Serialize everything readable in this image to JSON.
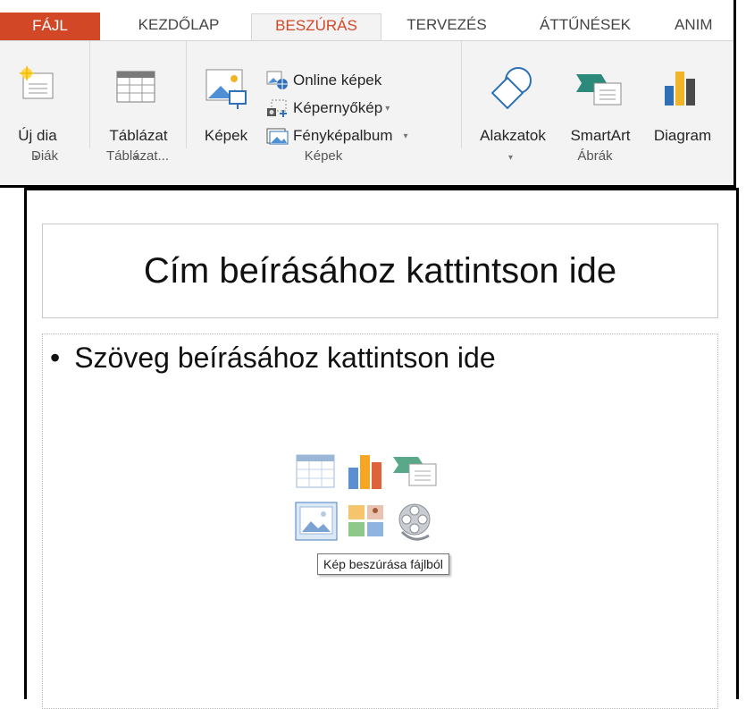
{
  "tabs": [
    {
      "label": "FÁJL"
    },
    {
      "label": "KEZDŐLAP"
    },
    {
      "label": "BESZÚRÁS"
    },
    {
      "label": "TERVEZÉS"
    },
    {
      "label": "ÁTTŰNÉSEK"
    },
    {
      "label": "ANIM"
    }
  ],
  "ribbon": {
    "new_slide": "Új dia",
    "table": "Táblázat",
    "pictures": "Képek",
    "online_pictures": "Online képek",
    "screenshot": "Képernyőkép",
    "photo_album": "Fényképalbum",
    "shapes": "Alakzatok",
    "smartart": "SmartArt",
    "chart": "Diagram",
    "groups": {
      "slides": "Diák",
      "tables": "Táblázat...",
      "images": "Képek",
      "illustrations": "Ábrák"
    }
  },
  "slide": {
    "title_placeholder": "Cím beírásához kattintson ide",
    "body_placeholder": "Szöveg beírásához kattintson ide",
    "bullet": "•",
    "tooltip": "Kép beszúrása fájlból"
  },
  "colors": {
    "accent": "#d24726",
    "ribbon_bg": "#f3f3f3"
  }
}
